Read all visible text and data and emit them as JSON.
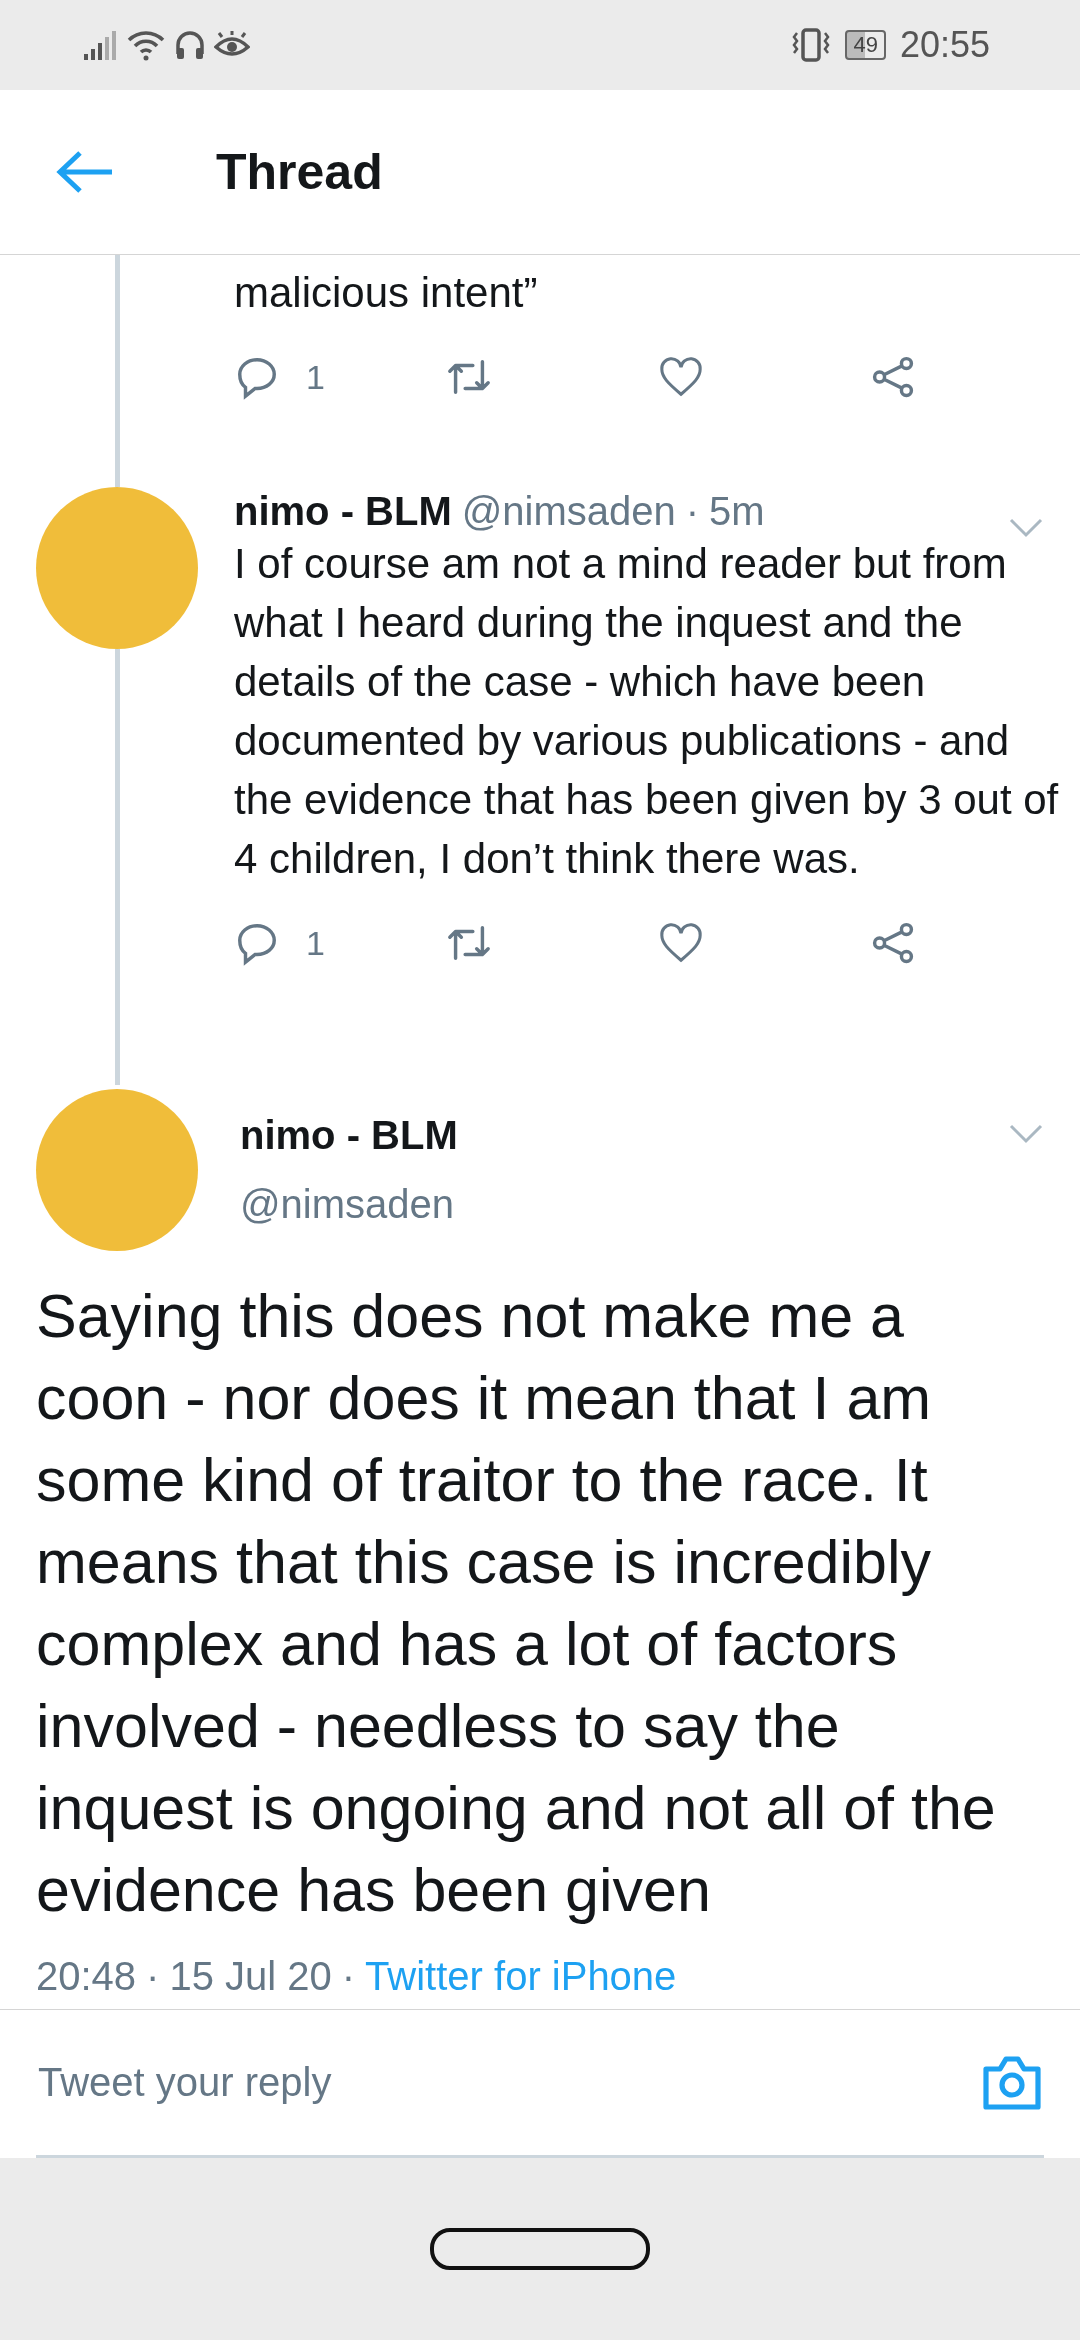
{
  "status_bar": {
    "battery": "49",
    "time": "20:55"
  },
  "header": {
    "title": "Thread"
  },
  "previous_tweet": {
    "text_tail": "malicious intent”",
    "reply_count": "1"
  },
  "reply_tweet": {
    "name": "nimo - BLM",
    "handle": "@nimsaden",
    "separator": "·",
    "age": "5m",
    "text": "I of course am not a mind reader but from what I heard during the inquest and the details of the case - which have been documented by various publications - and the evidence that has been given by 3 out of 4 children, I don’t think there was.",
    "reply_count": "1"
  },
  "main_tweet": {
    "name": "nimo - BLM",
    "handle": "@nimsaden",
    "text": "Saying this does not make me a coon - nor does it mean that I am some kind of traitor to the race. It means that this case is incredibly complex and has a lot of factors involved - needless to say the inquest is ongoing and not all of the evidence has been given",
    "time": "20:48",
    "separator_1": "·",
    "date": "15 Jul 20",
    "separator_2": "·",
    "source": "Twitter for iPhone"
  },
  "reply_box": {
    "placeholder": "Tweet your reply"
  }
}
